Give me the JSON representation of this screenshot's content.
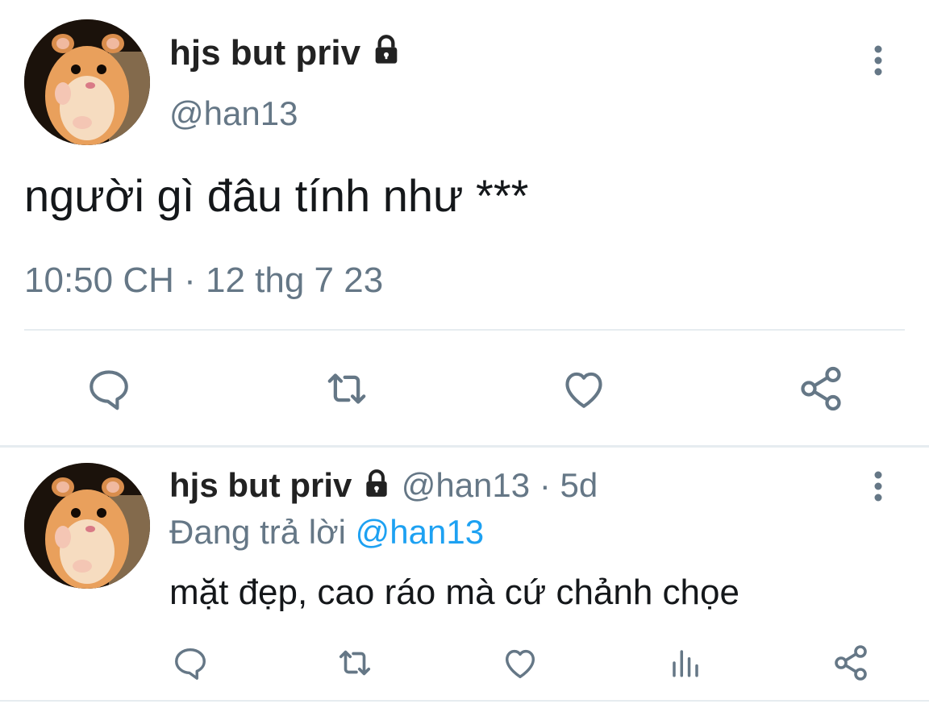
{
  "main_tweet": {
    "display_name": "hjs but priv",
    "handle": "@han13",
    "text": "người gì đâu tính như ***",
    "timestamp": "10:50 CH · 12 thg 7 23",
    "avatar_icon": "hamster-avatar",
    "actions": [
      "reply-icon",
      "retweet-icon",
      "like-icon",
      "share-icon"
    ]
  },
  "reply_tweet": {
    "display_name": "hjs but priv",
    "handle": "@han13",
    "separator": "·",
    "age": "5d",
    "replying_prefix": "Đang trả lời",
    "replying_to": "@han13",
    "text": "mặt đẹp, cao ráo mà cứ chảnh chọe",
    "avatar_icon": "hamster-avatar",
    "actions": [
      "reply-icon",
      "retweet-icon",
      "like-icon",
      "analytics-icon",
      "share-icon"
    ]
  },
  "colors": {
    "icon_gray": "#657786",
    "link_blue": "#1da1f2",
    "divider": "#e6ecf0",
    "text": "#14171a"
  }
}
